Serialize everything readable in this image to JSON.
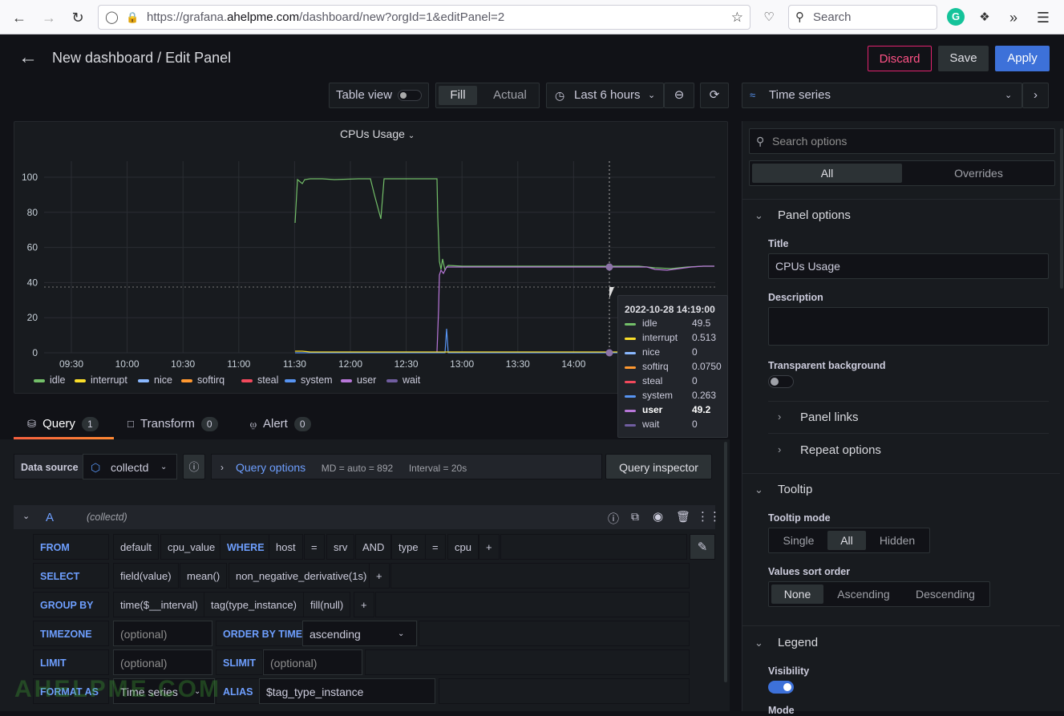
{
  "browser": {
    "url_prefix": "https://grafana.",
    "url_domain": "ahelpme.com",
    "url_path": "/dashboard/new?orgId=1&editPanel=2",
    "search_placeholder": "Search"
  },
  "header": {
    "title": "New dashboard / Edit Panel",
    "discard": "Discard",
    "save": "Save",
    "apply": "Apply"
  },
  "toolbar": {
    "table_view": "Table view",
    "fill": "Fill",
    "actual": "Actual",
    "time_range": "Last 6 hours",
    "visualization": "Time series"
  },
  "panel": {
    "title": "CPUs Usage"
  },
  "chart_data": {
    "type": "line",
    "title": "CPUs Usage",
    "x_ticks": [
      "09:30",
      "10:00",
      "10:30",
      "11:00",
      "11:30",
      "12:00",
      "12:30",
      "13:00",
      "13:30",
      "14:00"
    ],
    "y_ticks": [
      "0",
      "20",
      "40",
      "60",
      "80",
      "100"
    ],
    "ylim": [
      0,
      100
    ],
    "grid": true,
    "legend_position": "bottom",
    "series": [
      {
        "name": "idle",
        "color": "#73bf69"
      },
      {
        "name": "interrupt",
        "color": "#fade2a"
      },
      {
        "name": "nice",
        "color": "#8ab8ff"
      },
      {
        "name": "softirq",
        "color": "#ff9830"
      },
      {
        "name": "steal",
        "color": "#f2495c"
      },
      {
        "name": "system",
        "color": "#5794f2"
      },
      {
        "name": "user",
        "color": "#b877d9"
      },
      {
        "name": "wait",
        "color": "#705da0"
      }
    ]
  },
  "tooltip": {
    "time": "2022-10-28 14:19:00",
    "rows": [
      {
        "name": "idle",
        "value": "49.5",
        "color": "#73bf69"
      },
      {
        "name": "interrupt",
        "value": "0.513",
        "color": "#fade2a"
      },
      {
        "name": "nice",
        "value": "0",
        "color": "#8ab8ff"
      },
      {
        "name": "softirq",
        "value": "0.0750",
        "color": "#ff9830"
      },
      {
        "name": "steal",
        "value": "0",
        "color": "#f2495c"
      },
      {
        "name": "system",
        "value": "0.263",
        "color": "#5794f2"
      },
      {
        "name": "user",
        "value": "49.2",
        "color": "#b877d9"
      },
      {
        "name": "wait",
        "value": "0",
        "color": "#705da0"
      }
    ]
  },
  "tabs": {
    "query": "Query",
    "query_count": "1",
    "transform": "Transform",
    "transform_count": "0",
    "alert": "Alert",
    "alert_count": "0"
  },
  "query": {
    "data_source_label": "Data source",
    "data_source": "collectd",
    "query_options": "Query options",
    "md": "MD = auto = 892",
    "interval": "Interval = 20s",
    "inspector": "Query inspector",
    "ref": "A",
    "ref_source": "(collectd)",
    "from_kw": "FROM",
    "from_policy": "default",
    "from_measurement": "cpu_value",
    "where_kw": "WHERE",
    "w1_key": "host",
    "w1_op": "=",
    "w1_val": "srv",
    "and_kw": "AND",
    "w2_key": "type",
    "w2_op": "=",
    "w2_val": "cpu",
    "plus": "+",
    "select_kw": "SELECT",
    "sel1": "field(value)",
    "sel2": "mean()",
    "sel3": "non_negative_derivative(1s)",
    "groupby_kw": "GROUP BY",
    "gb1": "time($__interval)",
    "gb2": "tag(type_instance)",
    "gb3": "fill(null)",
    "timezone_kw": "TIMEZONE",
    "optional": "(optional)",
    "orderby_kw": "ORDER BY TIME",
    "orderby_val": "ascending",
    "limit_kw": "LIMIT",
    "slimit_kw": "SLIMIT",
    "format_kw": "FORMAT AS",
    "format_val": "Time series",
    "alias_kw": "ALIAS",
    "alias_val": "$tag_type_instance"
  },
  "options": {
    "search_placeholder": "Search options",
    "all": "All",
    "overrides": "Overrides",
    "panel_options": "Panel options",
    "title_label": "Title",
    "title_value": "CPUs Usage",
    "description_label": "Description",
    "transparent_label": "Transparent background",
    "panel_links": "Panel links",
    "repeat_options": "Repeat options",
    "tooltip_section": "Tooltip",
    "tooltip_mode_label": "Tooltip mode",
    "tm_single": "Single",
    "tm_all": "All",
    "tm_hidden": "Hidden",
    "sort_label": "Values sort order",
    "so_none": "None",
    "so_asc": "Ascending",
    "so_desc": "Descending",
    "legend_section": "Legend",
    "visibility_label": "Visibility",
    "mode_label": "Mode"
  },
  "watermark": "AHELPME.COM"
}
